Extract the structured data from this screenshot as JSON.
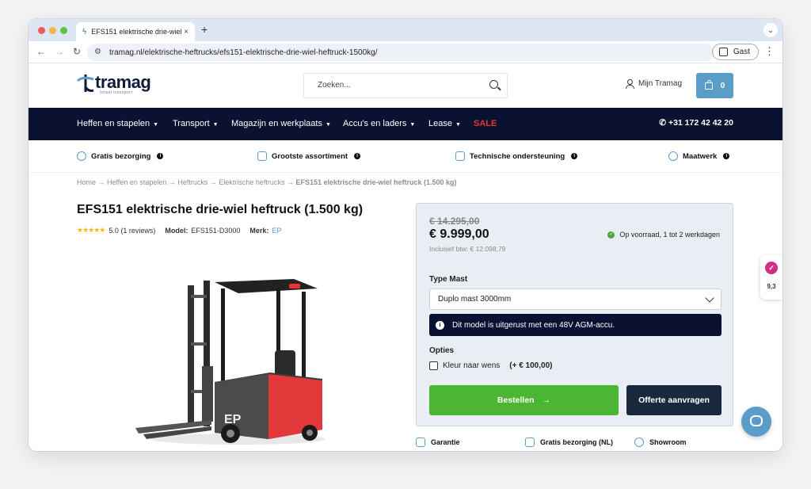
{
  "browser": {
    "tab_title": "EFS151 elektrische drie-wiel heftruck (1.500 kg)",
    "url": "tramag.nl/elektrische-heftrucks/efs151-elektrische-drie-wiel-heftruck-1500kg/",
    "profile": "Gast"
  },
  "header": {
    "logo_text": "tramag",
    "logo_tagline": "totaal transport",
    "search_placeholder": "Zoeken...",
    "account_label": "Mijn Tramag",
    "cart_count": "0"
  },
  "nav": {
    "items": [
      {
        "label": "Heffen en stapelen"
      },
      {
        "label": "Transport"
      },
      {
        "label": "Magazijn en werkplaats"
      },
      {
        "label": "Accu's en laders"
      },
      {
        "label": "Lease"
      }
    ],
    "sale_label": "SALE",
    "phone": "+31 172 42 42 20"
  },
  "usps": [
    {
      "label": "Gratis bezorging"
    },
    {
      "label": "Grootste assortiment"
    },
    {
      "label": "Technische ondersteuning"
    },
    {
      "label": "Maatwerk"
    }
  ],
  "breadcrumb": {
    "trail": "Home → Heffen en stapelen → Heftrucks → Elektrische heftrucks → ",
    "current": "EFS151 elektrische drie-wiel heftruck (1.500 kg)"
  },
  "product": {
    "title": "EFS151 elektrische drie-wiel heftruck (1.500 kg)",
    "rating": "5.0 (1 reviews)",
    "model_label": "Model:",
    "model_value": "EFS151-D3000",
    "brand_label": "Merk:",
    "brand_value": "EP",
    "image_brand": "EP"
  },
  "order": {
    "old_price": "€ 14.295,00",
    "price": "€ 9.999,00",
    "incl_vat": "Inclusief btw: € 12.098,79",
    "stock": "Op voorraad, 1 tot 2 werkdagen",
    "type_label": "Type Mast",
    "type_value": "Duplo mast 3000mm",
    "notice": "Dit model is uitgerust met een 48V AGM-accu.",
    "options_label": "Opties",
    "option_label": "Kleur naar wens",
    "option_price": "(+ € 100,00)",
    "order_button": "Bestellen",
    "quote_button": "Offerte aanvragen"
  },
  "bottom_usps": [
    {
      "label": "Garantie"
    },
    {
      "label": "Gratis bezorging (NL)"
    },
    {
      "label": "Showroom"
    }
  ],
  "review_badge": {
    "score": "9,3"
  },
  "colors": {
    "navy": "#0b1130",
    "accent": "#5b9dc9",
    "green": "#4cb533",
    "sale": "#e8362c"
  }
}
